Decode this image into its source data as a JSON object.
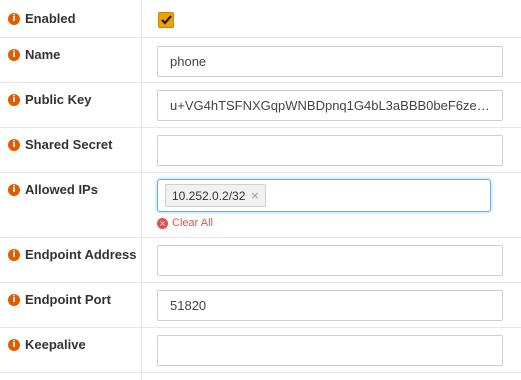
{
  "fields": {
    "enabled": {
      "label": "Enabled",
      "checked": true
    },
    "name": {
      "label": "Name",
      "value": "phone"
    },
    "public_key": {
      "label": "Public Key",
      "value": "u+VG4hTSFNXGqpWNBDpnq1G4bL3aBBB0beF6ze6j ..."
    },
    "shared_secret": {
      "label": "Shared Secret",
      "value": ""
    },
    "allowed_ips": {
      "label": "Allowed IPs",
      "tags": [
        "10.252.0.2/32"
      ],
      "clear_all_label": "Clear All"
    },
    "endpoint_address": {
      "label": "Endpoint Address",
      "value": ""
    },
    "endpoint_port": {
      "label": "Endpoint Port",
      "value": "51820"
    },
    "keepalive": {
      "label": "Keepalive",
      "value": ""
    }
  },
  "icons": {
    "info": "info-icon",
    "check": "check-icon",
    "remove": "remove-icon"
  },
  "colors": {
    "accent": "#f0a000",
    "info_icon": "#e35b00",
    "clear": "#d9534f",
    "focus": "#66afe9"
  }
}
